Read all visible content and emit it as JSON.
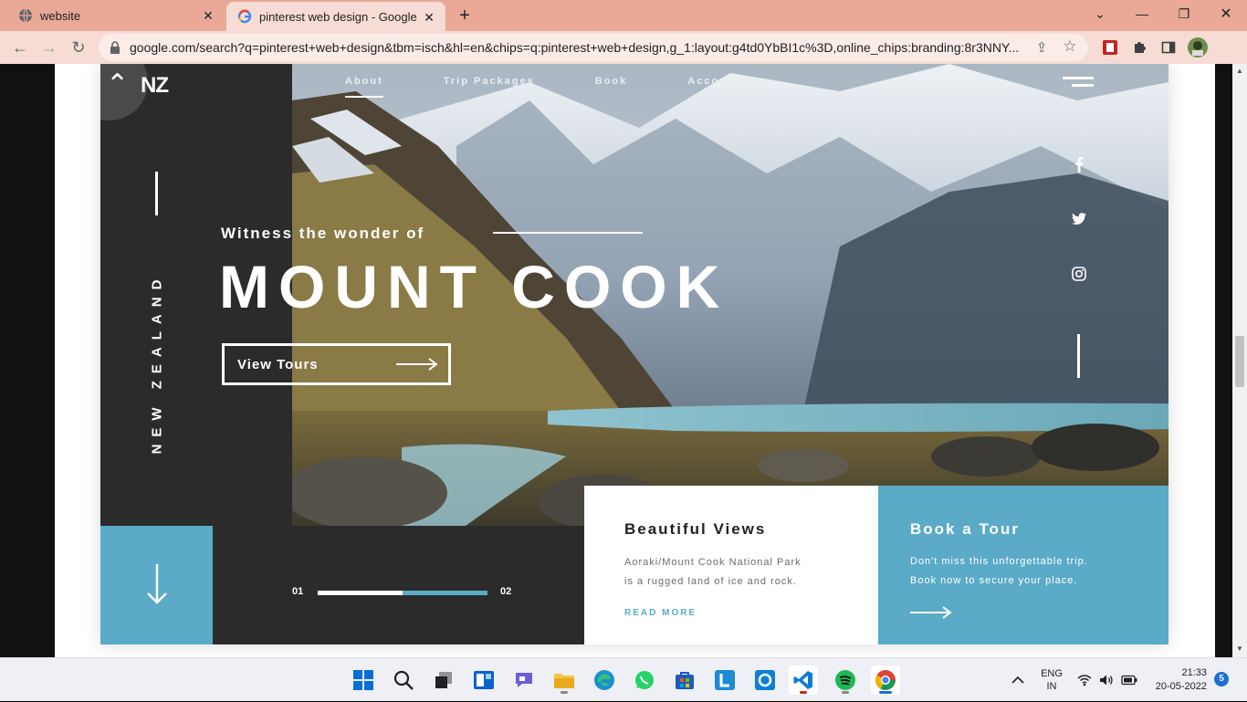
{
  "browser": {
    "tabs": [
      {
        "title": "website",
        "icon": "globe-icon",
        "active": false
      },
      {
        "title": "pinterest web design - Google Se",
        "icon": "google-icon",
        "active": true
      }
    ],
    "url": "google.com/search?q=pinterest+web+design&tbm=isch&hl=en&chips=q:pinterest+web+design,g_1:layout:g4td0YbBI1c%3D,online_chips:branding:8r3NNY..."
  },
  "design": {
    "logo": "NZ",
    "nav": [
      "About",
      "Trip Packages",
      "Book",
      "Account"
    ],
    "active_nav": "About",
    "side_text": "NEW ZEALAND",
    "tagline": "Witness the wonder of",
    "headline": "MOUNT COOK",
    "cta": "View Tours",
    "social": [
      "facebook-icon",
      "twitter-icon",
      "instagram-icon"
    ],
    "progress": {
      "start": "01",
      "end": "02",
      "value": 0.5
    },
    "card1": {
      "title": "Beautiful Views",
      "line1": "Aoraki/Mount Cook National Park",
      "line2": "is a rugged land of ice and rock.",
      "link": "READ MORE"
    },
    "card2": {
      "title": "Book a Tour",
      "line1": "Don't miss this unforgettable trip.",
      "line2": "Book now to secure your place."
    },
    "accent_color": "#5aaac8"
  },
  "taskbar": {
    "apps": [
      "windows-start-icon",
      "search-icon",
      "task-view-icon",
      "widgets-icon",
      "chat-icon",
      "file-explorer-icon",
      "edge-icon",
      "whatsapp-icon",
      "store-icon",
      "l-app-icon",
      "o-app-icon",
      "vscode-icon",
      "spotify-icon",
      "chrome-icon"
    ],
    "lang_top": "ENG",
    "lang_bottom": "IN",
    "time": "21:33",
    "date": "20-05-2022",
    "notifications": "5"
  }
}
